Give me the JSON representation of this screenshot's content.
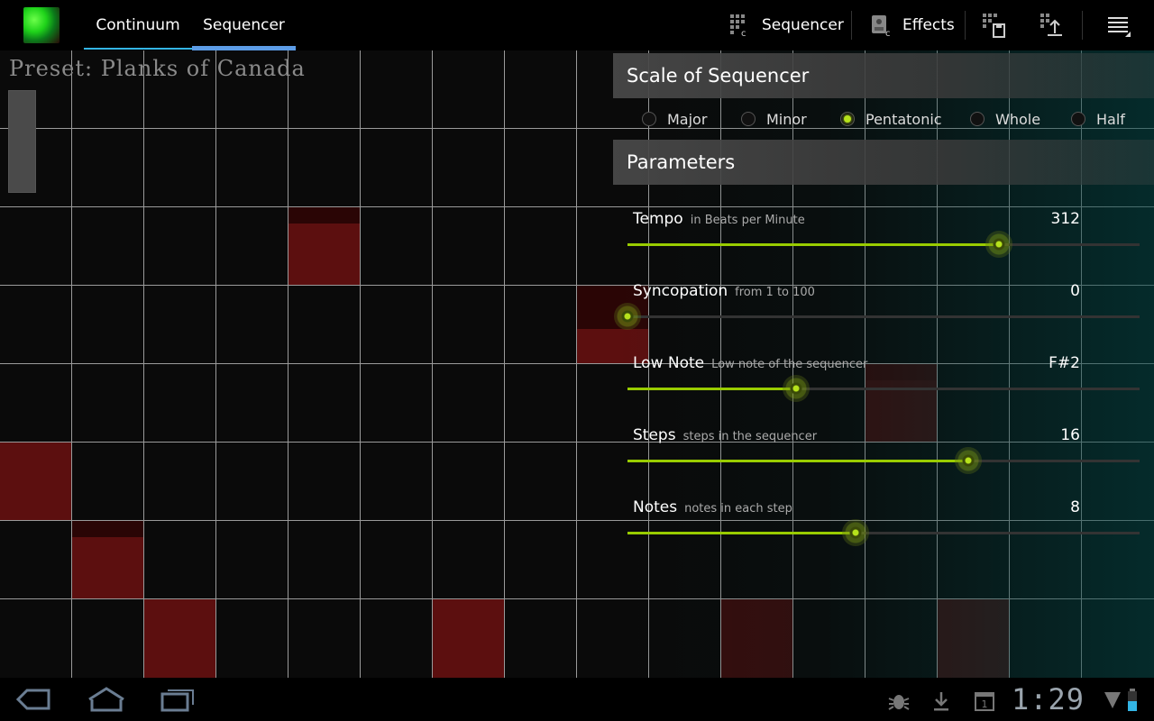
{
  "tabs": [
    {
      "label": "Continuum",
      "active": false
    },
    {
      "label": "Sequencer",
      "active": true
    }
  ],
  "actions": {
    "sequencer_label": "Sequencer",
    "effects_label": "Effects",
    "save_icon": "save-preset-icon",
    "load_icon": "load-preset-icon",
    "overflow_icon": "overflow-menu-icon"
  },
  "preset": {
    "label": "Preset: Planks of Canada",
    "level": 1.0
  },
  "sequencer_grid": {
    "columns": 16,
    "rows": 8,
    "active_cells": [
      {
        "col": 4,
        "row": 2
      },
      {
        "col": 8,
        "row": 3
      },
      {
        "col": 0,
        "row": 5
      },
      {
        "col": 1,
        "row": 6
      },
      {
        "col": 2,
        "row": 7
      },
      {
        "col": 6,
        "row": 7
      },
      {
        "col": 10,
        "row": 7
      },
      {
        "col": 12,
        "row": 4
      },
      {
        "col": 13,
        "row": 7
      }
    ]
  },
  "scale": {
    "heading": "Scale of Sequencer",
    "options": [
      "Major",
      "Minor",
      "Pentatonic",
      "Whole",
      "Half"
    ],
    "selected": "Pentatonic"
  },
  "parameters": {
    "heading": "Parameters",
    "items": [
      {
        "name": "Tempo",
        "desc": "in Beats per Minute",
        "value": "312",
        "position": 0.725
      },
      {
        "name": "Syncopation",
        "desc": "from 1 to 100",
        "value": "0",
        "position": 0.0
      },
      {
        "name": "Low Note",
        "desc": "Low note of the sequencer",
        "value": "F#2",
        "position": 0.33
      },
      {
        "name": "Steps",
        "desc": "steps in the sequencer",
        "value": "16",
        "position": 0.665
      },
      {
        "name": "Notes",
        "desc": "notes in each step",
        "value": "8",
        "position": 0.445
      }
    ]
  },
  "status": {
    "time": "1:29",
    "icons": [
      "debug-icon",
      "download-icon",
      "calendar-icon",
      "wifi-icon",
      "battery-icon"
    ],
    "calendar_day": "1"
  },
  "nav": {
    "icons": [
      "back-icon",
      "home-icon",
      "recent-apps-icon"
    ]
  },
  "colors": {
    "accent": "#99cc00",
    "tab_indicator": "#5c9ce6",
    "active_cell": "#5c0f0f"
  }
}
